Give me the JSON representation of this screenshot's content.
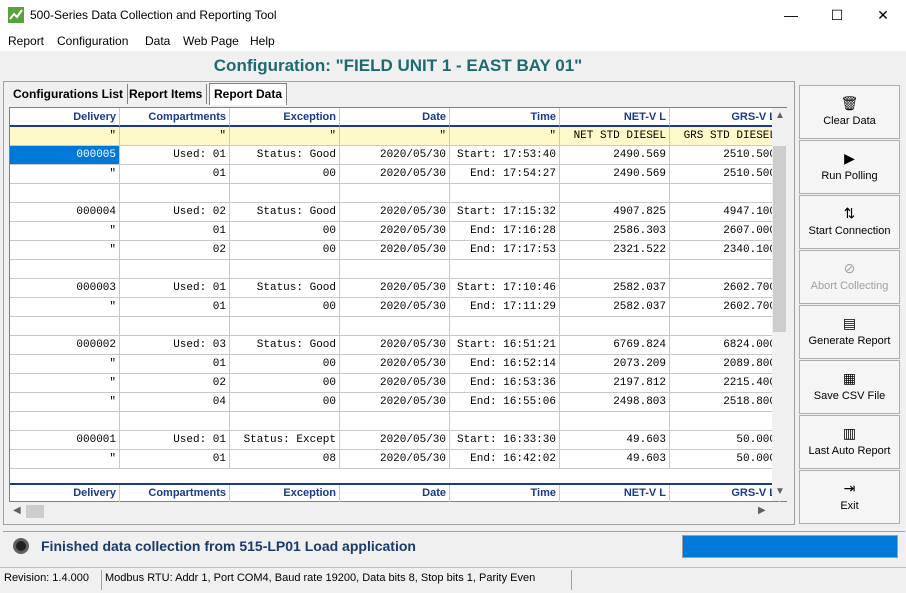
{
  "window": {
    "title": "500-Series Data Collection and Reporting Tool",
    "minimize": "—",
    "maximize": "☐",
    "close": "✕"
  },
  "menu": [
    "Report",
    "Configuration",
    "Data",
    "Web Page",
    "Help"
  ],
  "config_title": "Configuration: \"FIELD UNIT 1 - EAST BAY 01\"",
  "tabs": [
    "Configurations List",
    "Report Items",
    "Report Data"
  ],
  "columns": [
    "Delivery",
    "Compartments",
    "Exception",
    "Date",
    "Time",
    "NET-V  L",
    "GRS-V  L"
  ],
  "subheader": [
    "\"",
    "\"",
    "\"",
    "\"",
    "\"",
    "NET STD DIESEL",
    "GRS STD DIESEL"
  ],
  "rows": [
    [
      "000005",
      "Used: 01",
      "Status: Good",
      "2020/05/30",
      "Start: 17:53:40",
      "2490.569",
      "2510.500"
    ],
    [
      "\"",
      "01",
      "00",
      "2020/05/30",
      "End: 17:54:27",
      "2490.569",
      "2510.500"
    ],
    [
      "",
      "",
      "",
      "",
      "",
      "",
      ""
    ],
    [
      "000004",
      "Used: 02",
      "Status: Good",
      "2020/05/30",
      "Start: 17:15:32",
      "4907.825",
      "4947.100"
    ],
    [
      "\"",
      "01",
      "00",
      "2020/05/30",
      "End: 17:16:28",
      "2586.303",
      "2607.000"
    ],
    [
      "\"",
      "02",
      "00",
      "2020/05/30",
      "End: 17:17:53",
      "2321.522",
      "2340.100"
    ],
    [
      "",
      "",
      "",
      "",
      "",
      "",
      ""
    ],
    [
      "000003",
      "Used: 01",
      "Status: Good",
      "2020/05/30",
      "Start: 17:10:46",
      "2582.037",
      "2602.700"
    ],
    [
      "\"",
      "01",
      "00",
      "2020/05/30",
      "End: 17:11:29",
      "2582.037",
      "2602.700"
    ],
    [
      "",
      "",
      "",
      "",
      "",
      "",
      ""
    ],
    [
      "000002",
      "Used: 03",
      "Status: Good",
      "2020/05/30",
      "Start: 16:51:21",
      "6769.824",
      "6824.000"
    ],
    [
      "\"",
      "01",
      "00",
      "2020/05/30",
      "End: 16:52:14",
      "2073.209",
      "2089.800"
    ],
    [
      "\"",
      "02",
      "00",
      "2020/05/30",
      "End: 16:53:36",
      "2197.812",
      "2215.400"
    ],
    [
      "\"",
      "04",
      "00",
      "2020/05/30",
      "End: 16:55:06",
      "2498.803",
      "2518.800"
    ],
    [
      "",
      "",
      "",
      "",
      "",
      "",
      ""
    ],
    [
      "000001",
      "Used: 01",
      "Status: Except",
      "2020/05/30",
      "Start: 16:33:30",
      "49.603",
      "50.000"
    ],
    [
      "\"",
      "01",
      "08",
      "2020/05/30",
      "End: 16:42:02",
      "49.603",
      "50.000"
    ]
  ],
  "side_buttons": [
    {
      "label": "Clear Data",
      "icon": "trash-icon",
      "glyph": "🗑",
      "enabled": true
    },
    {
      "label": "Run Polling",
      "icon": "play-icon",
      "glyph": "▶",
      "enabled": true
    },
    {
      "label": "Start Connection",
      "icon": "connect-icon",
      "glyph": "⇅",
      "enabled": true
    },
    {
      "label": "Abort Collecting",
      "icon": "cancel-icon",
      "glyph": "⊘",
      "enabled": false
    },
    {
      "label": "Generate Report",
      "icon": "report-icon",
      "glyph": "▤",
      "enabled": true
    },
    {
      "label": "Save CSV File",
      "icon": "table-icon",
      "glyph": "▦",
      "enabled": true
    },
    {
      "label": "Last Auto Report",
      "icon": "document-icon",
      "glyph": "▥",
      "enabled": true
    },
    {
      "label": "Exit",
      "icon": "exit-door-icon",
      "glyph": "⇥",
      "enabled": true
    }
  ],
  "status_message": "Finished data collection from 515-LP01 Load application",
  "progress": 1.0,
  "revision": "Revision: 1.4.000",
  "connection": "Modbus RTU: Addr 1, Port COM4, Baud rate 19200, Data bits 8, Stop bits 1, Parity Even",
  "colors": {
    "accent": "#0078d7",
    "title_teal": "#1d6b70",
    "header_blue": "#1a3a8a",
    "subheader_yellow": "#fff8c8"
  }
}
